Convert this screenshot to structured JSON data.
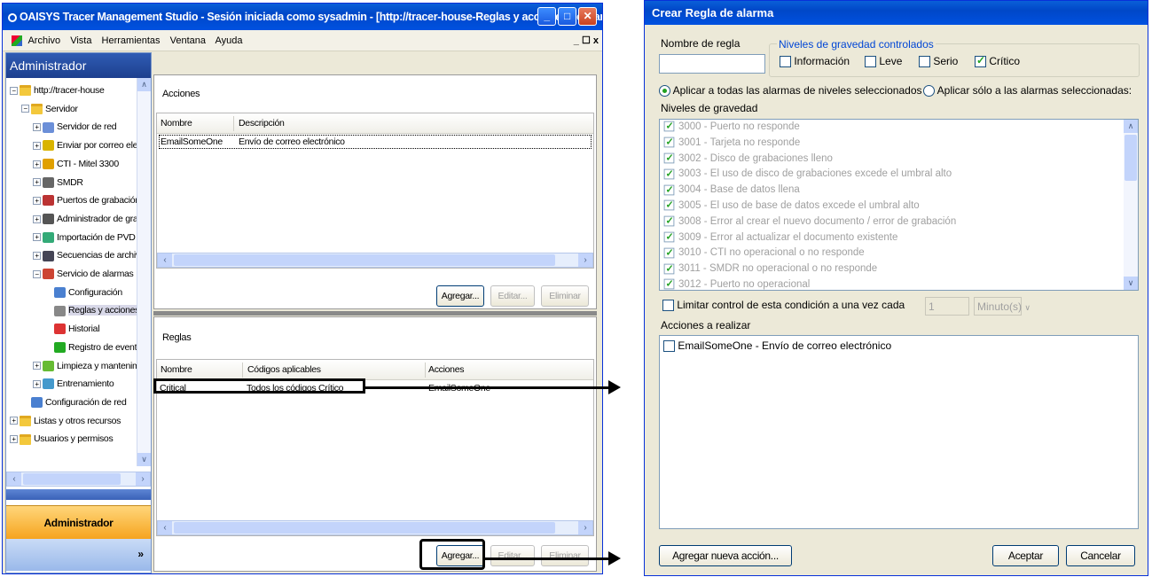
{
  "main_window": {
    "title": "OAISYS Tracer Management Studio - Sesión iniciada como sysadmin - [http://tracer-house-Reglas y acciones de alarma]",
    "menu": [
      "Archivo",
      "Vista",
      "Herramientas",
      "Ventana",
      "Ayuda"
    ],
    "menu_controls": "_ ☐ x",
    "left_panel_title": "Administrador",
    "tree": [
      {
        "label": "http://tracer-house",
        "icon": "folder-icon",
        "level": 0,
        "exp": "−"
      },
      {
        "label": "Servidor",
        "icon": "folder-icon",
        "level": 1,
        "exp": "−"
      },
      {
        "label": "Servidor de red",
        "icon": "network-server-icon",
        "level": 2,
        "exp": "+"
      },
      {
        "label": "Enviar por correo elec",
        "icon": "email-icon",
        "level": 2,
        "exp": "+"
      },
      {
        "label": "CTI - Mitel 3300",
        "icon": "cti-icon",
        "level": 2,
        "exp": "+"
      },
      {
        "label": "SMDR",
        "icon": "smdr-icon",
        "level": 2,
        "exp": "+"
      },
      {
        "label": "Puertos de grabación",
        "icon": "recording-ports-icon",
        "level": 2,
        "exp": "+"
      },
      {
        "label": "Administrador de grab.",
        "icon": "recording-admin-icon",
        "level": 2,
        "exp": "+"
      },
      {
        "label": "Importación de PVD",
        "icon": "import-icon",
        "level": 2,
        "exp": "+"
      },
      {
        "label": "Secuencias de archiv",
        "icon": "archive-icon",
        "level": 2,
        "exp": "+"
      },
      {
        "label": "Servicio de alarmas",
        "icon": "alarm-service-icon",
        "level": 2,
        "exp": "−"
      },
      {
        "label": "Configuración",
        "icon": "configuration-icon",
        "level": 3,
        "exp": ""
      },
      {
        "label": "Reglas y acciones",
        "icon": "rules-icon",
        "level": 3,
        "exp": ""
      },
      {
        "label": "Historial",
        "icon": "history-icon",
        "level": 3,
        "exp": ""
      },
      {
        "label": "Registro de event",
        "icon": "event-log-icon",
        "level": 3,
        "exp": ""
      },
      {
        "label": "Limpieza y mantenimie",
        "icon": "cleanup-icon",
        "level": 2,
        "exp": "+"
      },
      {
        "label": "Entrenamiento",
        "icon": "training-icon",
        "level": 2,
        "exp": "+"
      },
      {
        "label": "Configuración de red",
        "icon": "network-config-icon",
        "level": 1,
        "exp": ""
      },
      {
        "label": "Listas y otros recursos",
        "icon": "folder-icon",
        "level": 0,
        "exp": "+"
      },
      {
        "label": "Usuarios y permisos",
        "icon": "folder-icon",
        "level": 0,
        "exp": "+"
      }
    ],
    "admin_button": "Administrador",
    "nav_chevron": "»",
    "acciones": {
      "title": "Acciones",
      "columns": [
        "Nombre",
        "Descripción"
      ],
      "rows": [
        [
          "EmailSomeOne",
          "Envío de correo electrónico"
        ]
      ],
      "buttons": [
        "Agregar...",
        "Editar...",
        "Eliminar"
      ]
    },
    "reglas": {
      "title": "Reglas",
      "columns": [
        "Nombre",
        "Códigos aplicables",
        "Acciones"
      ],
      "rows": [
        [
          "Critical",
          "Todos los códigos Crítico",
          "EmailSomeOne"
        ]
      ],
      "buttons": [
        "Agregar...",
        "Editar...",
        "Eliminar"
      ]
    }
  },
  "dialog": {
    "title": "Crear Regla de alarma",
    "rule_name_label": "Nombre de regla",
    "rule_name_value": "",
    "severity_group_label": "Niveles de gravedad controlados",
    "severity_checks": [
      {
        "label": "Información",
        "checked": false
      },
      {
        "label": "Leve",
        "checked": false
      },
      {
        "label": "Serio",
        "checked": false
      },
      {
        "label": "Crítico",
        "checked": true
      }
    ],
    "radio_all": "Aplicar a todas las alarmas de niveles seleccionados",
    "radio_selected": "Aplicar sólo a las alarmas seleccionadas:",
    "levels_label": "Niveles de gravedad",
    "levels": [
      "3000 - Puerto no responde",
      "3001 - Tarjeta no responde",
      "3002 - Disco de grabaciones lleno",
      "3003 - El uso de disco de grabaciones excede el umbral alto",
      "3004 - Base de datos llena",
      "3005 - El uso de base de datos excede el umbral alto",
      "3008 - Error al crear el nuevo documento / error de grabación",
      "3009 - Error al actualizar el documento existente",
      "3010 - CTI no operacional o no responde",
      "3011 - SMDR no operacional o no responde",
      "3012 - Puerto no operacional"
    ],
    "limit_label": "Limitar control de esta condición a una vez cada",
    "limit_value": "1",
    "limit_unit": "Minuto(s)",
    "actions_label": "Acciones a realizar",
    "actions": [
      "EmailSomeOne - Envío de correo electrónico"
    ],
    "add_action_button": "Agregar nueva acción...",
    "ok_button": "Aceptar",
    "cancel_button": "Cancelar"
  }
}
